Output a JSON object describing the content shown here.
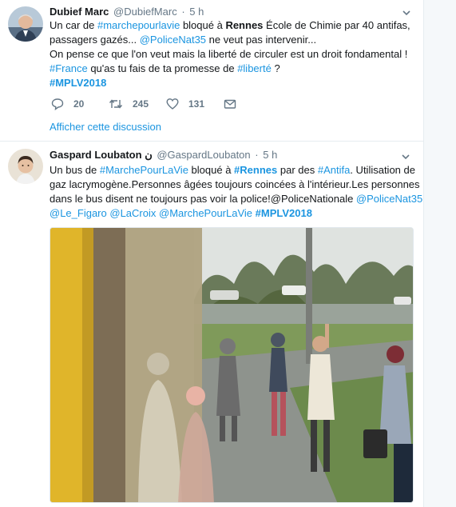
{
  "tweet1": {
    "author_name": "Dubief Marc",
    "author_handle": "@DubiefMarc",
    "separator": "·",
    "time": "5 h",
    "lines": [
      [
        {
          "t": "Un car de ",
          "c": "plain"
        },
        {
          "t": "#marchepourlavie",
          "c": "blue"
        },
        {
          "t": " bloqué à ",
          "c": "plain"
        },
        {
          "t": "Rennes",
          "c": "bold"
        },
        {
          "t": " École de Chimie par 40 antifas,",
          "c": "plain"
        }
      ],
      [
        {
          "t": "passagers gazés... ",
          "c": "plain"
        },
        {
          "t": "@PoliceNat35",
          "c": "blue"
        },
        {
          "t": " ne veut pas intervenir...",
          "c": "plain"
        }
      ],
      [
        {
          "t": "On pense ce que l'on veut mais la liberté de circuler est un droit fondamental !",
          "c": "plain"
        }
      ],
      [
        {
          "t": "#France",
          "c": "blue"
        },
        {
          "t": " qu'as tu fais de ta promesse de ",
          "c": "plain"
        },
        {
          "t": "#liberté",
          "c": "blue"
        },
        {
          "t": " ?",
          "c": "plain"
        }
      ],
      [
        {
          "t": "#MPLV2018",
          "c": "blue bold"
        }
      ]
    ],
    "replies": "20",
    "retweets": "245",
    "likes": "131",
    "show_thread": "Afficher cette discussion"
  },
  "tweet2": {
    "author_name": "Gaspard Loubaton",
    "author_symbol": "ن",
    "author_handle": "@GaspardLoubaton",
    "separator": "·",
    "time": "5 h",
    "lines": [
      [
        {
          "t": "Un bus de ",
          "c": "plain"
        },
        {
          "t": "#MarchePourLaVie",
          "c": "blue"
        },
        {
          "t": " bloqué à ",
          "c": "plain"
        },
        {
          "t": "#Rennes",
          "c": "blue bold"
        },
        {
          "t": " par des ",
          "c": "plain"
        },
        {
          "t": "#Antifa",
          "c": "blue"
        },
        {
          "t": ". Utilisation de",
          "c": "plain"
        }
      ],
      [
        {
          "t": "gaz lacrymogène.Personnes âgées toujours coincées à l'intérieur.Les personnes",
          "c": "plain"
        }
      ],
      [
        {
          "t": "dans le bus disent ne toujours pas voir la police!@PoliceNationale ",
          "c": "plain"
        },
        {
          "t": "@PoliceNat35",
          "c": "blue"
        }
      ],
      [
        {
          "t": "@Le_Figaro",
          "c": "blue"
        },
        {
          "t": " ",
          "c": "plain"
        },
        {
          "t": "@LaCroix",
          "c": "blue"
        },
        {
          "t": " ",
          "c": "plain"
        },
        {
          "t": "@MarchePourLaVie",
          "c": "blue"
        },
        {
          "t": " ",
          "c": "plain"
        },
        {
          "t": "#MPLV2018",
          "c": "blue bold"
        }
      ]
    ]
  },
  "colors": {
    "link": "#1b95e0",
    "text": "#14171a",
    "muted": "#657786",
    "divider": "#e6ecf0"
  },
  "icons": {
    "reply": "reply-icon",
    "retweet": "retweet-icon",
    "like": "heart-icon",
    "dm": "envelope-icon",
    "menu": "chevron-down-icon"
  }
}
